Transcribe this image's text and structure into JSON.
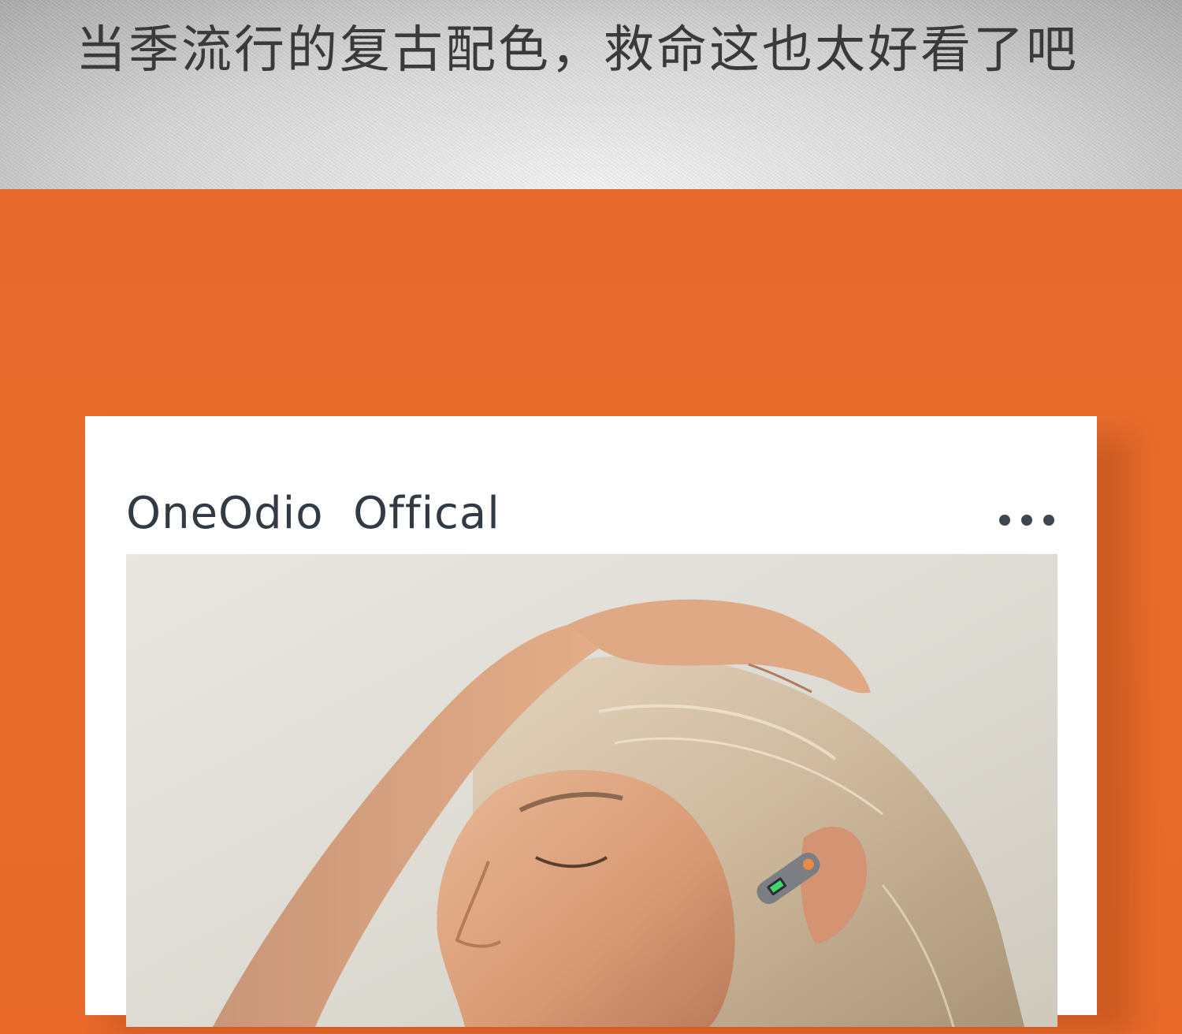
{
  "banner": {
    "headline": "当季流行的复古配色，救命这也太好看了吧"
  },
  "post": {
    "account_name": "OneOdio  Offical",
    "more_icon": "more-dots-icon",
    "photo_icon": "photo-woman-earbud"
  },
  "colors": {
    "accent_orange": "#e86a2a",
    "card_bg": "#ffffff",
    "text_dark": "#333a44"
  }
}
